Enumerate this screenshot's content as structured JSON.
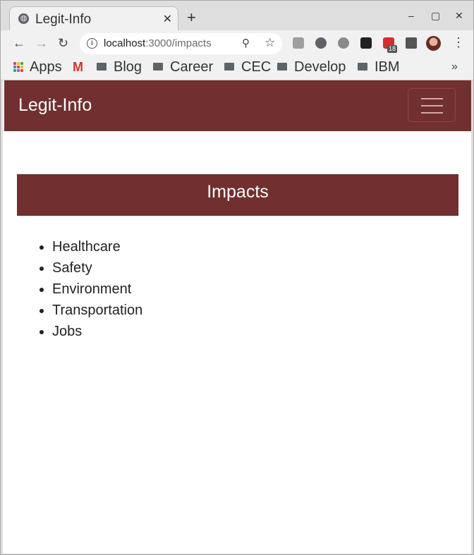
{
  "browser": {
    "tab_title": "Legit-Info",
    "url_host": "localhost",
    "url_path": ":3000/impacts",
    "extension_badge": "18",
    "controls": {
      "close_tab": "✕",
      "new_tab": "+",
      "minimize": "–",
      "maximize": "▢",
      "close": "✕",
      "back": "←",
      "forward": "→",
      "reload": "↻",
      "zoom": "⚲",
      "star": "☆",
      "menu": "⋮",
      "more_bookmarks": "»"
    },
    "bookmarks": [
      "Apps",
      "Blog",
      "Career",
      "CEC",
      "Develop",
      "IBM"
    ]
  },
  "app": {
    "brand": "Legit-Info",
    "page_title": "Impacts",
    "impacts": [
      "Healthcare",
      "Safety",
      "Environment",
      "Transportation",
      "Jobs"
    ],
    "colors": {
      "primary": "#722f2f",
      "text": "#222222"
    }
  }
}
